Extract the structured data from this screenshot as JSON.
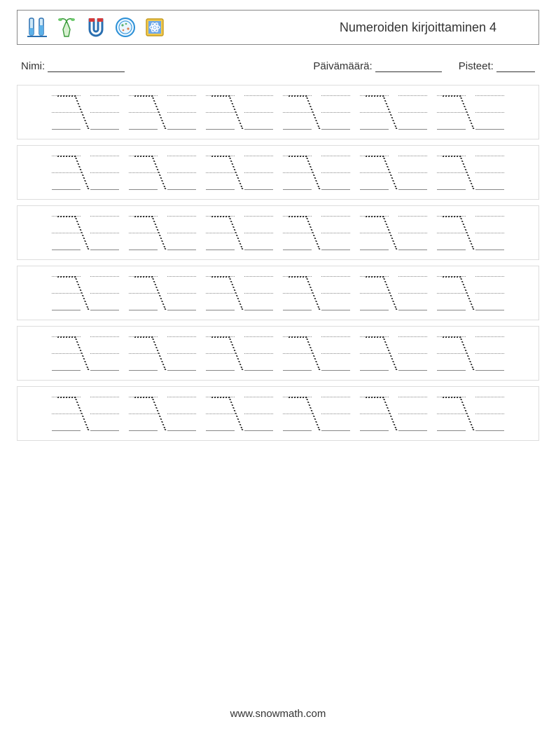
{
  "header": {
    "title": "Numeroiden kirjoittaminen 4"
  },
  "meta": {
    "name_label": "Nimi:",
    "date_label": "Päivämäärä:",
    "score_label": "Pisteet:"
  },
  "practice": {
    "rows": 6,
    "cells_per_row": 12,
    "traced_digit": "7",
    "trace_positions": [
      0,
      2,
      4,
      6,
      8,
      10
    ]
  },
  "footer": {
    "url": "www.snowmath.com"
  },
  "icons": {
    "i1": "test-tubes-icon",
    "i2": "sprout-flask-icon",
    "i3": "magnet-icon",
    "i4": "petri-dish-icon",
    "i5": "atom-book-icon"
  }
}
